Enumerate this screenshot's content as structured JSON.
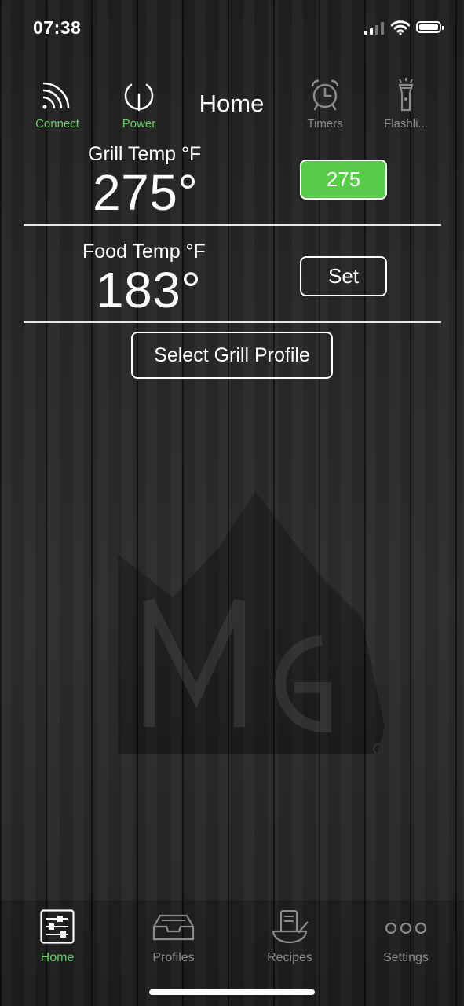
{
  "status": {
    "time": "07:38"
  },
  "top_nav": {
    "connect": "Connect",
    "power": "Power",
    "title": "Home",
    "timers": "Timers",
    "flashlight": "Flashli..."
  },
  "grill": {
    "label": "Grill Temp °F",
    "value": "275°",
    "target": "275"
  },
  "food": {
    "label": "Food Temp °F",
    "value": "183°",
    "set_label": "Set"
  },
  "profile_button": "Select Grill Profile",
  "tabs": [
    {
      "label": "Home",
      "icon": "sliders-icon",
      "active": true
    },
    {
      "label": "Profiles",
      "icon": "tray-icon",
      "active": false
    },
    {
      "label": "Recipes",
      "icon": "cooking-icon",
      "active": false
    },
    {
      "label": "Settings",
      "icon": "ellipsis-icon",
      "active": false
    }
  ],
  "colors": {
    "accent": "#5fd15f",
    "button_green": "#58cc4a",
    "inactive": "#8c8c8c"
  }
}
